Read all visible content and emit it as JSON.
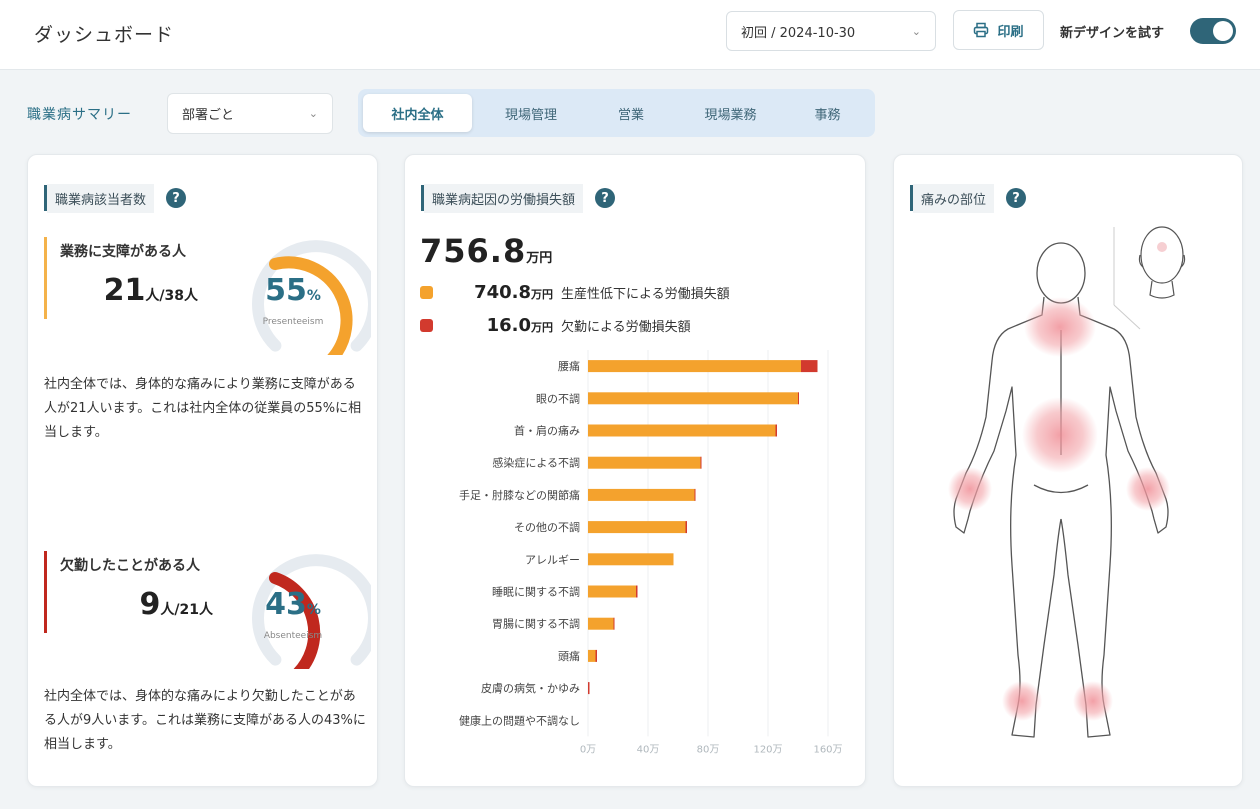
{
  "header": {
    "title": "ダッシュボード",
    "date_select": "初回 / 2024-10-30",
    "print_label": "印刷",
    "new_design_label": "新デザインを試す",
    "new_design_on": true
  },
  "filters": {
    "summary_label": "職業病サマリー",
    "dept_select": "部署ごと",
    "tabs": [
      {
        "label": "社内全体",
        "active": true
      },
      {
        "label": "現場管理",
        "active": false
      },
      {
        "label": "営業",
        "active": false
      },
      {
        "label": "現場業務",
        "active": false
      },
      {
        "label": "事務",
        "active": false
      }
    ]
  },
  "count_card": {
    "title": "職業病該当者数",
    "presenteeism": {
      "label": "業務に支障がある人",
      "count": "21",
      "unit": "人/38人",
      "percent": "55",
      "percent_sign": "%",
      "fraction": 0.55,
      "caption": "Presenteeism",
      "description": "社内全体では、身体的な痛みにより業務に支障がある人が21人います。これは社内全体の従業員の55%に相当します。",
      "color": "#f4a22d"
    },
    "absenteeism": {
      "label": "欠勤したことがある人",
      "count": "9",
      "unit": "人/21人",
      "percent": "43",
      "percent_sign": "%",
      "fraction": 0.43,
      "caption": "Absenteeism",
      "description": "社内全体では、身体的な痛みにより欠勤したことがある人が9人います。これは業務に支障がある人の43%に相当します。",
      "color": "#c0281e"
    }
  },
  "loss_card": {
    "title": "職業病起因の労働損失額",
    "total_value": "756.8",
    "total_unit": "万円",
    "legend": [
      {
        "value": "740.8",
        "unit": "万円",
        "label": "生産性低下による労働損失額",
        "color": "#f4a22d"
      },
      {
        "value": "16.0",
        "unit": "万円",
        "label": "欠勤による労働損失額",
        "color": "#d23a2e"
      }
    ]
  },
  "chart_data": {
    "type": "bar",
    "orientation": "horizontal",
    "stacked": true,
    "categories": [
      "腰痛",
      "眼の不調",
      "首・肩の痛み",
      "感染症による不調",
      "手足・肘膝などの関節痛",
      "その他の不調",
      "アレルギー",
      "睡眠に関する不調",
      "胃腸に関する不調",
      "頭痛",
      "皮膚の病気・かゆみ",
      "健康上の問題や不調なし"
    ],
    "series": [
      {
        "name": "生産性低下による労働損失額",
        "color": "#f4a22d",
        "values": [
          1420000,
          1400000,
          1250000,
          750000,
          710000,
          650000,
          570000,
          320000,
          170000,
          50000,
          0,
          0
        ]
      },
      {
        "name": "欠勤による労働損失額",
        "color": "#d23a2e",
        "values": [
          110000,
          5000,
          10000,
          5000,
          5000,
          10000,
          0,
          10000,
          5000,
          10000,
          10000,
          0
        ]
      }
    ],
    "xticks": [
      "0万",
      "40万",
      "80万",
      "120万",
      "160万"
    ],
    "xlim": [
      0,
      1600000
    ],
    "grid": true
  },
  "pain_card": {
    "title": "痛みの部位",
    "areas": [
      "首・肩",
      "腰",
      "左手首",
      "右手首",
      "左足首",
      "右足首"
    ],
    "highlight_color": "#f3a6ab"
  },
  "icons": {
    "help": "?",
    "chevron": "⌄",
    "print": "printer-icon"
  }
}
